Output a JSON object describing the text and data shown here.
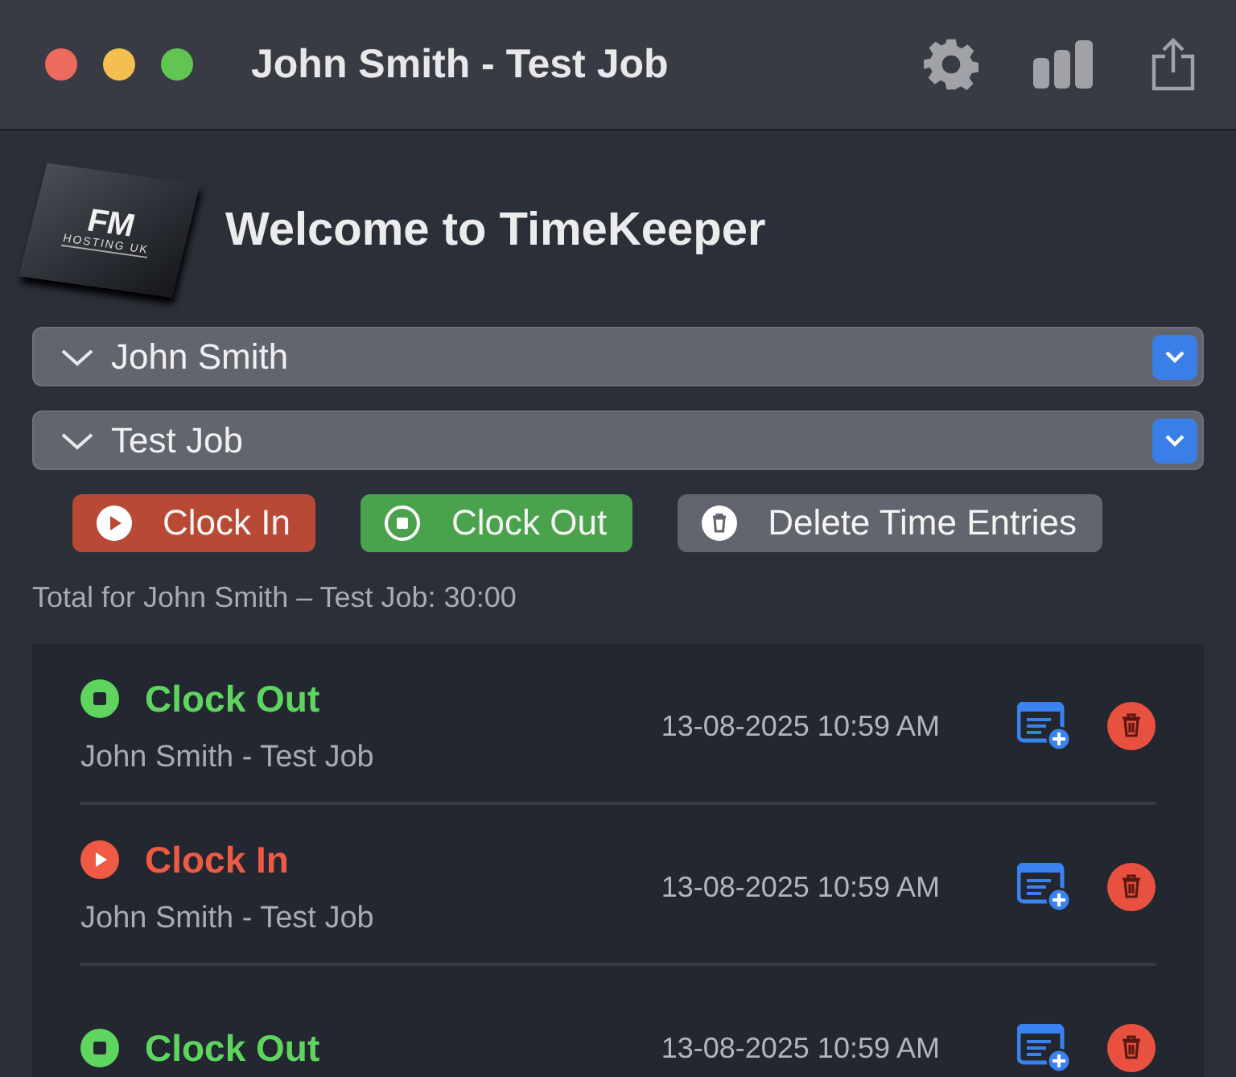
{
  "window": {
    "title": "John Smith - Test Job"
  },
  "logo": {
    "name": "FM",
    "subtitle": "HOSTING UK"
  },
  "heading": "Welcome to TimeKeeper",
  "selectors": [
    {
      "value": "John Smith"
    },
    {
      "value": "Test Job"
    }
  ],
  "actions": [
    {
      "kind": "clock_in",
      "label": "Clock In"
    },
    {
      "kind": "clock_out",
      "label": "Clock Out"
    },
    {
      "kind": "delete",
      "label": "Delete Time Entries"
    }
  ],
  "total": "Total for John Smith – Test Job: 30:00",
  "entries": [
    {
      "kind": "clock_out",
      "title": "Clock Out",
      "subtitle": "John Smith - Test Job",
      "time": "13-08-2025 10:59 AM"
    },
    {
      "kind": "clock_in",
      "title": "Clock In",
      "subtitle": "John Smith - Test Job",
      "time": "13-08-2025 10:59 AM"
    },
    {
      "kind": "clock_out",
      "title": "Clock Out",
      "time": "13-08-2025 10:59 AM"
    }
  ]
}
